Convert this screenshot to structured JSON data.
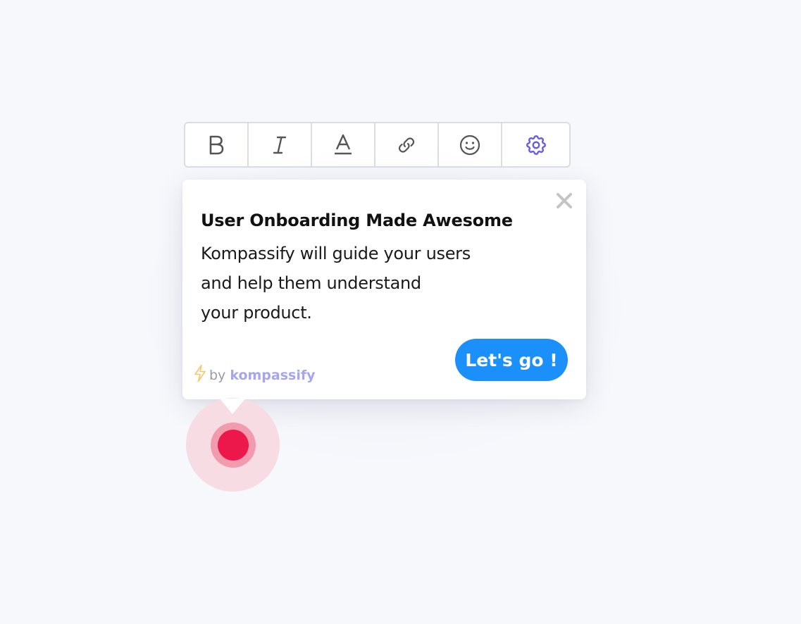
{
  "toolbar": {
    "tools": [
      {
        "name": "bold",
        "icon": "bold-icon"
      },
      {
        "name": "italic",
        "icon": "italic-icon"
      },
      {
        "name": "text-color",
        "icon": "text-color-icon"
      },
      {
        "name": "link",
        "icon": "link-icon"
      },
      {
        "name": "emoji",
        "icon": "smiley-icon"
      },
      {
        "name": "settings",
        "icon": "gear-icon"
      }
    ]
  },
  "tooltip": {
    "title": "User Onboarding Made Awesome",
    "body_lines": [
      "Kompassify will guide your users",
      "and help them understand",
      "your product."
    ],
    "close_icon": "close-icon",
    "credit": {
      "icon": "lightning-icon",
      "by": "by",
      "brand": "kompassify"
    },
    "cta_label": "Let's go !"
  },
  "beacon": {
    "icon": "hotspot-beacon"
  },
  "colors": {
    "background": "#f7f8fc",
    "accent_blue": "#1b90fb",
    "gear_purple": "#6a5ee0",
    "brand_purple": "#a8a6ea",
    "beacon_red": "#ec174b"
  }
}
